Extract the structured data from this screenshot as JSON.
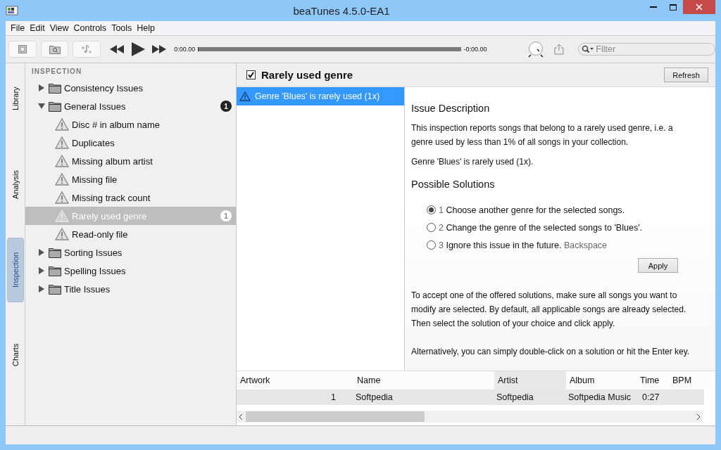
{
  "window": {
    "title": "beaTunes 4.5.0-EA1"
  },
  "menu": [
    "File",
    "Edit",
    "View",
    "Controls",
    "Tools",
    "Help"
  ],
  "player": {
    "elapsed": "0:00.00",
    "remaining": "-0:00.00",
    "level": 0
  },
  "filter": {
    "placeholder": "Filter"
  },
  "side_tabs": [
    {
      "label": "Library",
      "selected": false
    },
    {
      "label": "Analysis",
      "selected": false
    },
    {
      "label": "Inspection",
      "selected": true
    },
    {
      "label": "Charts",
      "selected": false
    }
  ],
  "tree": {
    "heading": "INSPECTION",
    "items": [
      {
        "label": "Consistency Issues",
        "kind": "folder",
        "expanded": false,
        "selected": false
      },
      {
        "label": "General Issues",
        "kind": "folder",
        "expanded": true,
        "selected": false,
        "badge": "1",
        "children": [
          {
            "label": "Disc # in album name",
            "kind": "issue",
            "selected": false
          },
          {
            "label": "Duplicates",
            "kind": "issue",
            "selected": false
          },
          {
            "label": "Missing album artist",
            "kind": "issue",
            "selected": false
          },
          {
            "label": "Missing file",
            "kind": "issue",
            "selected": false
          },
          {
            "label": "Missing track count",
            "kind": "issue",
            "selected": false
          },
          {
            "label": "Rarely used genre",
            "kind": "issue",
            "selected": true,
            "badge": "1"
          },
          {
            "label": "Read-only file",
            "kind": "issue",
            "selected": false
          }
        ]
      },
      {
        "label": "Sorting Issues",
        "kind": "folder",
        "expanded": false,
        "selected": false
      },
      {
        "label": "Spelling Issues",
        "kind": "folder",
        "expanded": false,
        "selected": false
      },
      {
        "label": "Title Issues",
        "kind": "folder",
        "expanded": false,
        "selected": false
      }
    ]
  },
  "inspection": {
    "title": "Rarely used genre",
    "checked": true,
    "refresh": "Refresh",
    "issues": [
      {
        "label": "Genre 'Blues' is rarely used (1x)",
        "selected": true
      }
    ],
    "description_heading": "Issue Description",
    "description": "This inspection reports songs that belong to a rarely used genre, i.e. a genre used by less than 1% of all songs in your collection.",
    "detail": "Genre 'Blues' is rarely used (1x).",
    "solutions_heading": "Possible Solutions",
    "solutions": [
      {
        "number": "1",
        "text": "Choose another genre for the selected songs.",
        "selected": true
      },
      {
        "number": "2",
        "text": "Change the genre of the selected songs to 'Blues'.",
        "selected": false
      },
      {
        "number": "3",
        "text": "Ignore this issue in the future.",
        "shortcut": "Backspace",
        "selected": false
      }
    ],
    "apply": "Apply",
    "help": [
      "To accept one of the offered solutions, make sure all songs you want to modify are selected. By default, all applicable songs are already selected. Then select the solution of your choice and click apply.",
      "Alternatively, you can simply double-click on a solution or hit the Enter key."
    ]
  },
  "table": {
    "columns": [
      {
        "label": "Artwork",
        "sorted": false
      },
      {
        "label": "Name",
        "sorted": false
      },
      {
        "label": "Artist",
        "sorted": true
      },
      {
        "label": "Album",
        "sorted": false
      },
      {
        "label": "Time",
        "sorted": false
      },
      {
        "label": "BPM",
        "sorted": false
      }
    ],
    "rows": [
      {
        "cells": [
          "1",
          "Softpedia",
          "Softpedia",
          "Softpedia Music",
          "0:27"
        ]
      }
    ]
  }
}
